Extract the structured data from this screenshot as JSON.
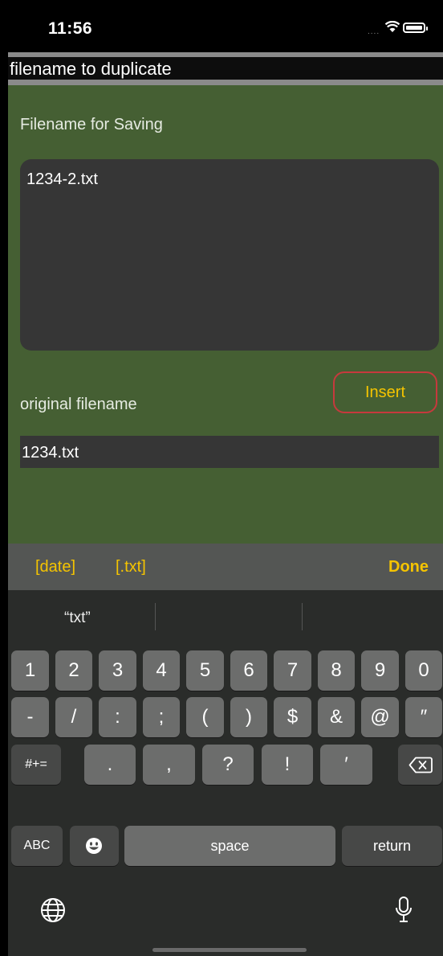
{
  "status_bar": {
    "time": "11:56"
  },
  "title_bar": {
    "title": "filename to duplicate"
  },
  "form": {
    "save_label": "Filename for Saving",
    "save_value": "1234-2.txt",
    "original_label": "original filename",
    "original_value": "1234.txt",
    "insert_label": "Insert"
  },
  "keyboard": {
    "accessory": {
      "date_label": "[date]",
      "txt_label": "[.txt]",
      "done_label": "Done"
    },
    "suggestion": "“txt”",
    "row1": [
      "1",
      "2",
      "3",
      "4",
      "5",
      "6",
      "7",
      "8",
      "9",
      "0"
    ],
    "row2": [
      "-",
      "/",
      ":",
      ";",
      "(",
      ")",
      "$",
      "&",
      "@",
      "″"
    ],
    "row3": {
      "mode": "#+=",
      "keys": [
        ".",
        ",",
        "?",
        "!",
        "′"
      ]
    },
    "row4": {
      "abc": "ABC",
      "space": "space",
      "return": "return"
    }
  },
  "colors": {
    "content_bg": "#455f33",
    "accent_yellow": "#f5c400",
    "insert_border": "#c6393d",
    "field_bg": "#363636"
  }
}
